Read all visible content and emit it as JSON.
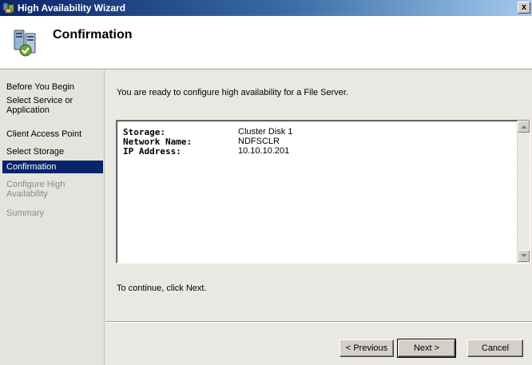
{
  "window": {
    "title": "High Availability Wizard",
    "close_label": "x"
  },
  "header": {
    "title": "Confirmation"
  },
  "sidebar": {
    "items": [
      {
        "label": "Before You Begin",
        "state": "normal"
      },
      {
        "label": "Select Service or Application",
        "state": "normal"
      },
      {
        "label": "Client Access Point",
        "state": "normal"
      },
      {
        "label": "Select Storage",
        "state": "normal"
      },
      {
        "label": "Confirmation",
        "state": "active"
      },
      {
        "label": "Configure High Availability",
        "state": "disabled"
      },
      {
        "label": "Summary",
        "state": "disabled"
      }
    ]
  },
  "main": {
    "intro": "You are ready to configure high availability for a File Server.",
    "summary": [
      {
        "label": "Storage:",
        "value": "Cluster Disk 1"
      },
      {
        "label": "Network Name:",
        "value": "NDFSCLR"
      },
      {
        "label": "IP Address:",
        "value": "10.10.10.201"
      }
    ],
    "continue_text": "To continue, click Next."
  },
  "footer": {
    "previous_label": "< Previous",
    "next_label": "Next >",
    "cancel_label": "Cancel"
  },
  "colors": {
    "titlebar": "#0a246a",
    "active_nav": "#0a246a",
    "disabled_nav": "#8a8a8a"
  }
}
